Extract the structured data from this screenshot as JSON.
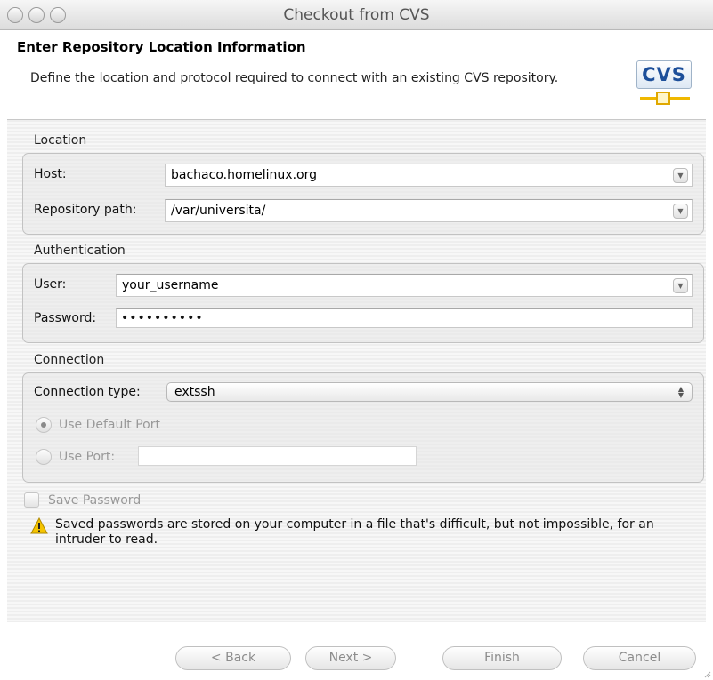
{
  "window": {
    "title": "Checkout from CVS"
  },
  "header": {
    "title": "Enter Repository Location Information",
    "description": "Define the location and protocol required to connect with an existing CVS repository.",
    "logo_text": "CVS"
  },
  "location": {
    "group_label": "Location",
    "host_label": "Host:",
    "host_value": "bachaco.homelinux.org",
    "repo_label": "Repository path:",
    "repo_value": "/var/universita/"
  },
  "authentication": {
    "group_label": "Authentication",
    "user_label": "User:",
    "user_value": "your_username",
    "password_label": "Password:",
    "password_value": "••••••••••"
  },
  "connection": {
    "group_label": "Connection",
    "type_label": "Connection type:",
    "type_value": "extssh",
    "default_port_label": "Use Default Port",
    "use_port_label": "Use Port:",
    "port_value": ""
  },
  "save_password": {
    "label": "Save Password",
    "warning": "Saved passwords are stored on your computer in a file that's difficult, but not impossible, for an intruder to read."
  },
  "buttons": {
    "back": "< Back",
    "next": "Next >",
    "finish": "Finish",
    "cancel": "Cancel"
  },
  "colors": {
    "warning_icon": "#f5c400",
    "accent_blue": "#1d4f9a"
  }
}
